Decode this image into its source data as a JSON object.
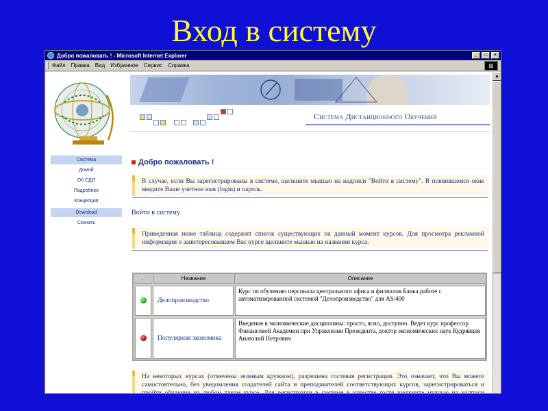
{
  "slide": {
    "title": "Вход в систему"
  },
  "window": {
    "title": "Добро пожаловать ! - Microsoft Internet Explorer",
    "controls": [
      "_",
      "□",
      "×"
    ]
  },
  "menu": [
    "Файл",
    "Правка",
    "Вид",
    "Избранное",
    "Сервис",
    "Справка"
  ],
  "header": {
    "system_title": "Система Дистанционного Обучения"
  },
  "sidebar": {
    "items": [
      {
        "label": "Система",
        "highlight": true
      },
      {
        "label": "Домой",
        "highlight": false
      },
      {
        "label": "Об СДО",
        "highlight": false
      },
      {
        "label": "Подробнее",
        "highlight": false
      },
      {
        "label": "Концепция",
        "highlight": false
      },
      {
        "label": "Download",
        "highlight": true
      },
      {
        "label": "Скачать",
        "highlight": false
      }
    ]
  },
  "main": {
    "welcome": "Добро пожаловать !",
    "note1": "В случае, если Вы зарегистрированы в системе, щелкните мышью на надписи \"Войти в систему\". В появившемся окне введите Ваше учетное имя (login) и пароль.",
    "login_link": "Войти в систему",
    "note2": "Приведенная ниже таблица содержит список существующих на данный момент курсов. Для просмотра рекламной информации о заинтересовавшем Вас курсе щелкните мышью на названии курса.",
    "table": {
      "headers": [
        ".",
        "Название",
        "Описание"
      ],
      "rows": [
        {
          "status_color": "#22aa22",
          "name": "Делопроизводство",
          "description": "Курс по обучению персонала центрального офиса и филиалов Банка работе с автоматизированной системой \"Делопроизводство\" для AS/400"
        },
        {
          "status_color": "#aa1111",
          "name": "Популярная экономика",
          "description": "Введение в экономические дисциплины: просто, ясно, доступно. Ведет курс профессор Финансовой Академии при Управлении Президента, доктор экономических наук Кудрявцев Анатолий Петрович"
        }
      ]
    },
    "note3": "На некоторых курсах (отмечены зеленым кружком), разрешена гостевая регистрация. Это означает, что Вы можете самостоятельно, без уведомления создателей сайта и преподавателей соответствующих курсов, зарегистрироваться и пройти обучение на любом таком курсе. Для регистрации в системе в качестве гостя щелкните мышью на надписи \"Гостевая регистрация\"."
  },
  "colors": {
    "slide_bg": "#0f0fd6",
    "title": "#ffff33",
    "text": "#1a2f7a"
  }
}
